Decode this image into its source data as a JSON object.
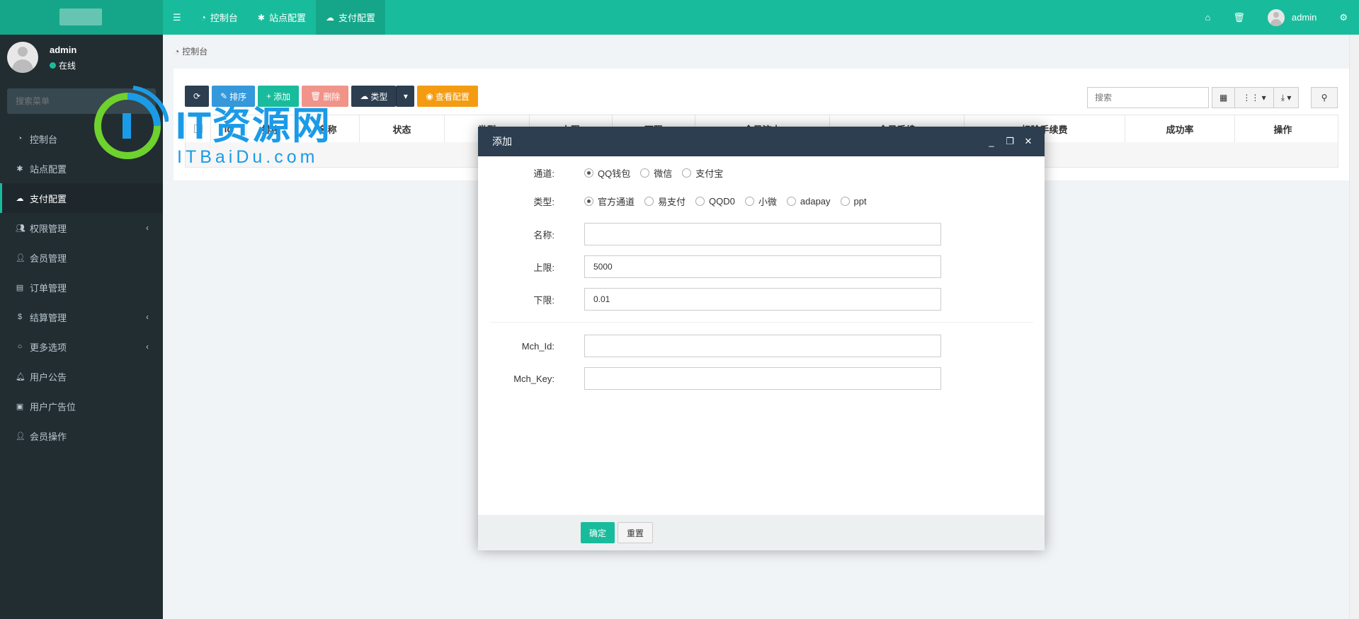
{
  "topnav": {
    "menu_toggle_icon": "bars-icon",
    "items": [
      {
        "label": "控制台",
        "icon": "dashboard-icon"
      },
      {
        "label": "站点配置",
        "icon": "gear-icon"
      },
      {
        "label": "支付配置",
        "icon": "cloud-icon"
      }
    ],
    "right": {
      "home_icon": "home-icon",
      "trash_icon": "trash-icon",
      "username": "admin",
      "settings_icon": "cogs-icon"
    }
  },
  "sidebar": {
    "user": {
      "name": "admin",
      "status": "在线",
      "status_color": "#18bc9c"
    },
    "search_placeholder": "搜索菜单",
    "items": [
      {
        "label": "控制台",
        "icon": "dashboard-icon",
        "has_children": false
      },
      {
        "label": "站点配置",
        "icon": "gear-icon",
        "has_children": false
      },
      {
        "label": "支付配置",
        "icon": "cloud-icon",
        "has_children": false,
        "active": true
      },
      {
        "label": "权限管理",
        "icon": "users-icon",
        "has_children": true
      },
      {
        "label": "会员管理",
        "icon": "user-icon",
        "has_children": false
      },
      {
        "label": "订单管理",
        "icon": "briefcase-icon",
        "has_children": false
      },
      {
        "label": "结算管理",
        "icon": "dollar-icon",
        "has_children": true
      },
      {
        "label": "更多选项",
        "icon": "circle-icon",
        "has_children": true
      },
      {
        "label": "用户公告",
        "icon": "bell-icon",
        "has_children": false
      },
      {
        "label": "用户广告位",
        "icon": "archive-icon",
        "has_children": false
      },
      {
        "label": "会员操作",
        "icon": "user-icon",
        "has_children": false
      }
    ]
  },
  "breadcrumb": {
    "label": "控制台",
    "icon": "dashboard-icon"
  },
  "toolbar": {
    "refresh_icon": "refresh-icon",
    "sort_label": "排序",
    "add_label": "添加",
    "delete_label": "删除",
    "type_label": "类型",
    "view_config_label": "查看配置",
    "search_placeholder": "搜索"
  },
  "table": {
    "columns": [
      "Id",
      "排序",
      "名称",
      "状态",
      "类型",
      "上限",
      "下限",
      "今日流水",
      "今日手续",
      "扣除手续费",
      "成功率",
      "操作"
    ]
  },
  "watermark": {
    "title": "IT资源网",
    "subtitle": "ITBaiDu.com"
  },
  "modal": {
    "title": "添加",
    "channel_label": "通道:",
    "channel_options": [
      {
        "label": "QQ钱包",
        "checked": true
      },
      {
        "label": "微信",
        "checked": false
      },
      {
        "label": "支付宝",
        "checked": false
      }
    ],
    "type_label": "类型:",
    "type_options": [
      {
        "label": "官方通道",
        "checked": true
      },
      {
        "label": "易支付",
        "checked": false
      },
      {
        "label": "QQD0",
        "checked": false
      },
      {
        "label": "小微",
        "checked": false
      },
      {
        "label": "adapay",
        "checked": false
      },
      {
        "label": "ppt",
        "checked": false
      }
    ],
    "name_label": "名称:",
    "name_value": "",
    "upper_label": "上限:",
    "upper_value": "5000",
    "lower_label": "下限:",
    "lower_value": "0.01",
    "mchid_label": "Mch_Id:",
    "mchid_value": "",
    "mchkey_label": "Mch_Key:",
    "mchkey_value": "",
    "confirm_label": "确定",
    "reset_label": "重置"
  },
  "colors": {
    "accent": "#18bc9c",
    "dark": "#2c3e50",
    "sidebar": "#222d32",
    "blue": "#3498db",
    "orange": "#f39c12",
    "red": "#e74c3c"
  }
}
